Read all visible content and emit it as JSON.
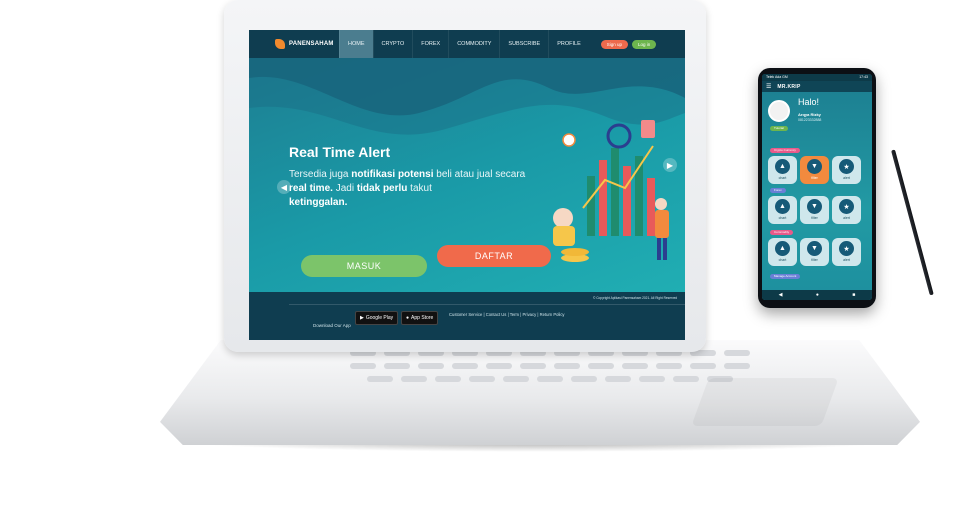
{
  "website": {
    "logo": {
      "small_text": "Aplikasi",
      "name": "PANENSAHAM"
    },
    "nav_items": [
      {
        "label": "HOME",
        "active": true
      },
      {
        "label": "CRYPTO",
        "active": false
      },
      {
        "label": "FOREX",
        "active": false
      },
      {
        "label": "COMMODITY",
        "active": false
      },
      {
        "label": "SUBSCRIBE",
        "active": false
      },
      {
        "label": "PROFILE",
        "active": false
      }
    ],
    "signup_label": "Sign up",
    "login_label": "Log in",
    "hero": {
      "title": "Real Time Alert",
      "body": {
        "p1": "Tersedia juga ",
        "b1": "notifikasi potensi",
        "p2": " beli atau jual secara ",
        "b2": "real time.",
        "p3": " Jadi ",
        "b3": "tidak perlu",
        "p4": " takut ",
        "b4": "ketinggalan."
      },
      "masuk_label": "MASUK",
      "daftar_label": "DAFTAR",
      "prev_icon": "chevron-left-icon",
      "next_icon": "chevron-right-icon"
    },
    "footer": {
      "download_label": "Download Our App",
      "google_play": "Google Play",
      "app_store": "App Store",
      "links": "Customer Service | Contact Us | Term | Privacy | Return Policy",
      "copyright": "© Copyright Aplikasi Panensaham 2021. All Right Reserved"
    }
  },
  "phone": {
    "status_left": "Telek Ada GM",
    "status_right": "17:43",
    "brand": "MR.KRIP",
    "greeting": "Halo!",
    "user_name": "Arqya Rizky",
    "user_phone": "081223332888",
    "badge": "Tutorial",
    "sections": [
      {
        "label": "Crypto Currency",
        "color": "#e85a8a"
      },
      {
        "label": "Forex",
        "color": "#6a7fd6"
      },
      {
        "label": "Commodity",
        "color": "#e85a8a"
      },
      {
        "label": "Manage Account",
        "color": "#6a7fd6"
      }
    ],
    "tiles_row1": [
      "chart",
      "filter",
      "alert"
    ],
    "tiles_row2": [
      "chart",
      "filter",
      "alert"
    ],
    "tiles_row3": [
      "chart",
      "filter",
      "alert"
    ],
    "nav_icons": [
      "back-icon",
      "home-icon",
      "recent-icon"
    ]
  },
  "colors": {
    "hero_start": "#1d7e92",
    "hero_end": "#22b3b6",
    "nav": "#0f3d50",
    "cta_green": "#7cc46a",
    "cta_orange": "#f06a4b",
    "phone_highlight": "#f28a3e"
  }
}
